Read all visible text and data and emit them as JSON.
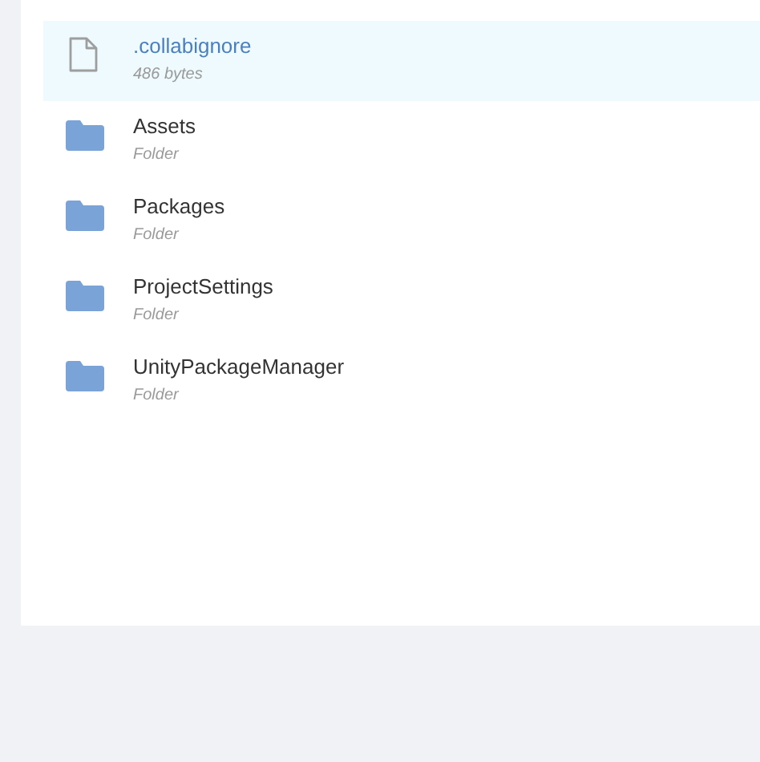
{
  "files": [
    {
      "kind": "file",
      "name": ".collabignore",
      "detail": "486 bytes",
      "selected": true
    },
    {
      "kind": "folder",
      "name": "Assets",
      "detail": "Folder",
      "selected": false
    },
    {
      "kind": "folder",
      "name": "Packages",
      "detail": "Folder",
      "selected": false
    },
    {
      "kind": "folder",
      "name": "ProjectSettings",
      "detail": "Folder",
      "selected": false
    },
    {
      "kind": "folder",
      "name": "UnityPackageManager",
      "detail": "Folder",
      "selected": false
    }
  ]
}
